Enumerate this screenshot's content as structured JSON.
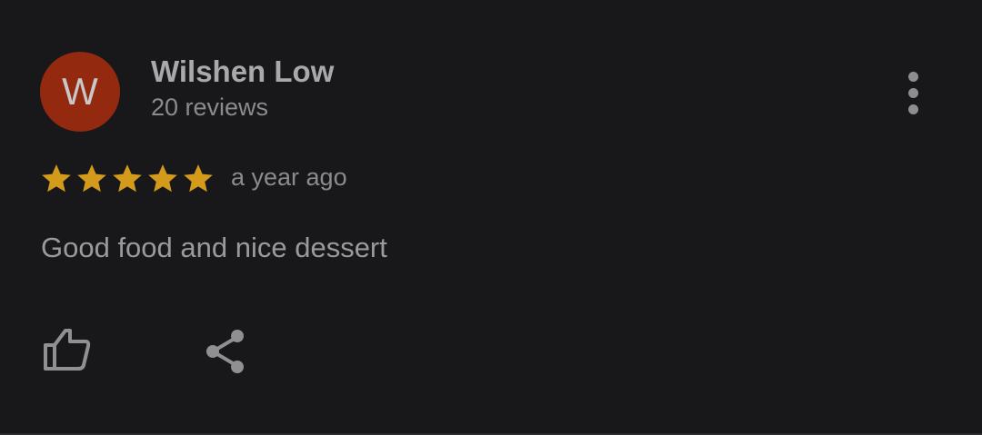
{
  "review": {
    "author": {
      "initial": "W",
      "name": "Wilshen Low",
      "review_count": "20 reviews",
      "avatar_color": "#93290f"
    },
    "rating": {
      "value": 5,
      "max": 5,
      "star_color": "#d39a1c"
    },
    "time": "a year ago",
    "text": "Good food and nice dessert",
    "actions": {
      "like_icon": "thumb-up-icon",
      "share_icon": "share-icon",
      "more_icon": "more-vertical-icon"
    }
  }
}
